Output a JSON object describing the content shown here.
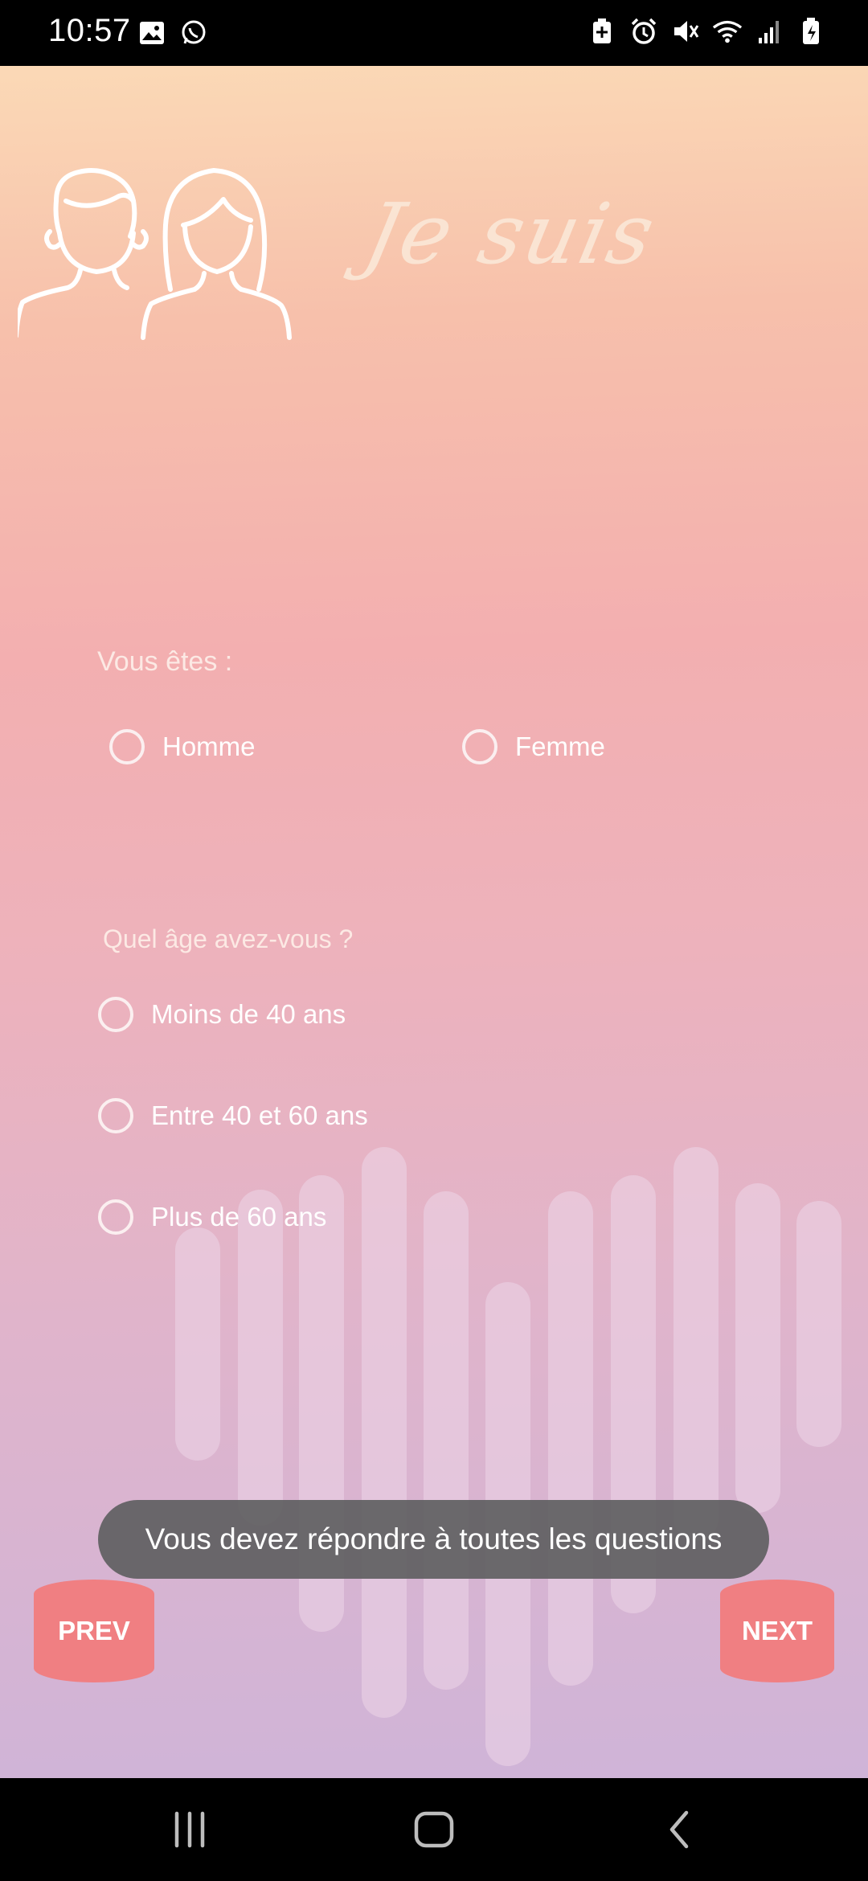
{
  "status_bar": {
    "time": "10:57",
    "left_icons": [
      "image-icon",
      "whatsapp-icon"
    ],
    "right_icons": [
      "battery-saver-icon",
      "alarm-icon",
      "mute-icon",
      "wifi-icon",
      "signal-icon",
      "battery-icon"
    ]
  },
  "header": {
    "title": "Je suis",
    "illustration": "people-icon"
  },
  "question_gender": {
    "label": "Vous êtes :",
    "options": [
      "Homme",
      "Femme"
    ]
  },
  "question_age": {
    "label": "Quel âge avez-vous ?",
    "options": [
      "Moins de 40 ans",
      "Entre 40 et 60 ans",
      "Plus de 60 ans"
    ]
  },
  "toast": {
    "message": "Vous devez répondre à toutes les questions"
  },
  "buttons": {
    "prev": "PREV",
    "next": "NEXT"
  },
  "colors": {
    "accent": "#f07f82",
    "toast_bg": "#5f5f61"
  }
}
